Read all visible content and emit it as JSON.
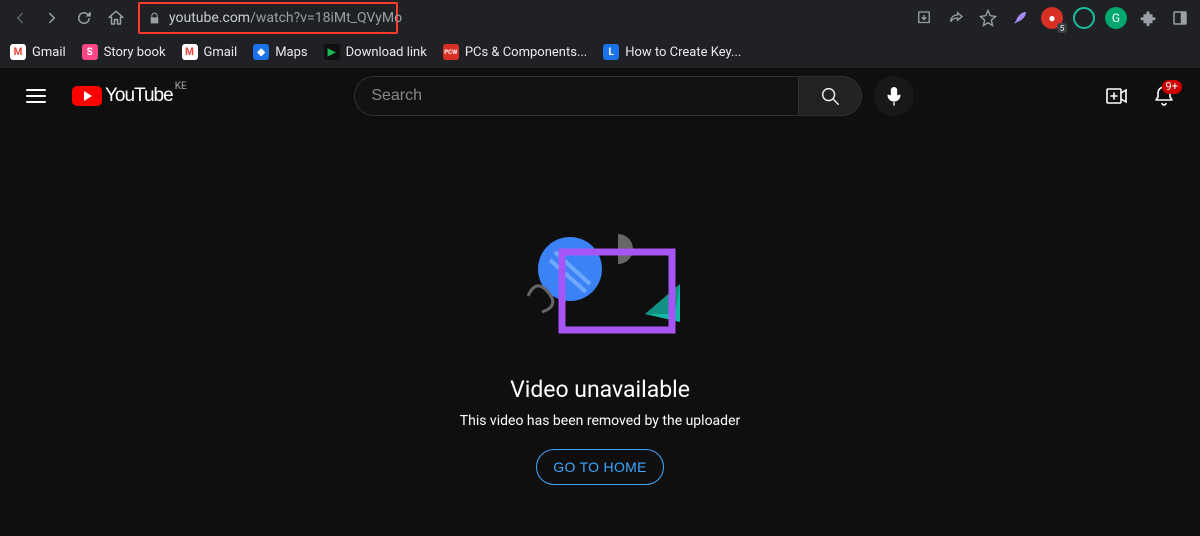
{
  "browser": {
    "url_host": "youtube.com",
    "url_path": "/watch?v=18iMt_QVyMo",
    "bookmarks": [
      {
        "label": "Gmail",
        "icon_bg": "#ffffff",
        "icon_fg": "#ea4335",
        "icon_text": "M"
      },
      {
        "label": "Story book",
        "icon_bg": "#ff4785",
        "icon_fg": "#ffffff",
        "icon_text": "S"
      },
      {
        "label": "Gmail",
        "icon_bg": "#ffffff",
        "icon_fg": "#ea4335",
        "icon_text": "M"
      },
      {
        "label": "Maps",
        "icon_bg": "#1a73e8",
        "icon_fg": "#ffffff",
        "icon_text": "◆"
      },
      {
        "label": "Download link",
        "icon_bg": "#0f0f0f",
        "icon_fg": "#1db954",
        "icon_text": "▶"
      },
      {
        "label": "PCs & Components...",
        "icon_bg": "#d93025",
        "icon_fg": "#ffffff",
        "icon_text": "PCW"
      },
      {
        "label": "How to Create Key...",
        "icon_bg": "#1a73e8",
        "icon_fg": "#ffffff",
        "icon_text": "L"
      }
    ],
    "ext_badge": "5"
  },
  "yt": {
    "logo_text": "YouTube",
    "country": "KE",
    "search_placeholder": "Search",
    "notif_badge": "9+"
  },
  "error": {
    "title": "Video unavailable",
    "subtitle": "This video has been removed by the uploader",
    "cta": "GO TO HOME"
  }
}
